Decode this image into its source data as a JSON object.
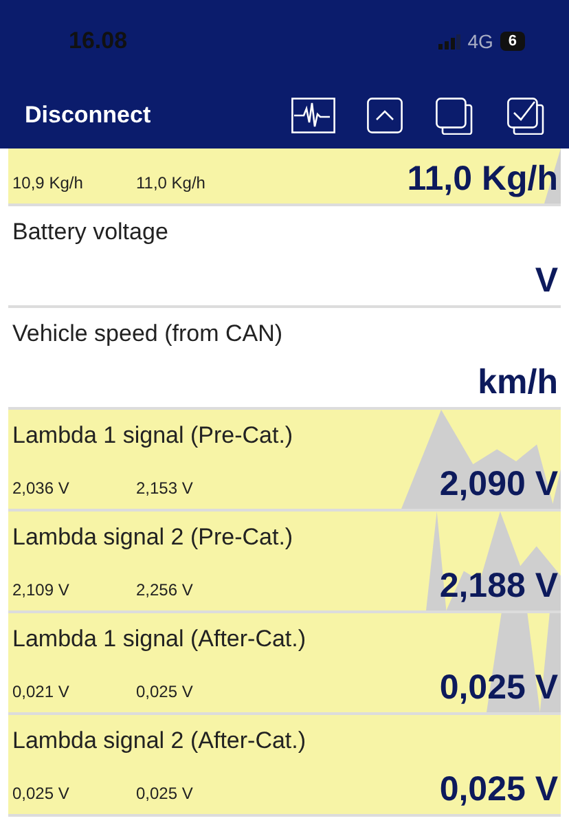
{
  "status_bar": {
    "time": "16.08",
    "network": "4G",
    "battery": "6"
  },
  "nav_bar": {
    "disconnect": "Disconnect"
  },
  "rows": [
    {
      "title": null,
      "highlighted": true,
      "graph": true,
      "min": "10,9 Kg/h",
      "max": "11,0 Kg/h",
      "value": "11,0 Kg/h"
    },
    {
      "title": "Battery voltage",
      "highlighted": false,
      "graph": false,
      "value": "V"
    },
    {
      "title": "Vehicle speed (from CAN)",
      "highlighted": false,
      "graph": false,
      "value": "km/h"
    },
    {
      "title": "Lambda 1 signal (Pre-Cat.)",
      "highlighted": true,
      "graph": true,
      "min": "2,036 V",
      "max": "2,153 V",
      "value": "2,090 V"
    },
    {
      "title": "Lambda signal 2 (Pre-Cat.)",
      "highlighted": true,
      "graph": true,
      "min": "2,109 V",
      "max": "2,256 V",
      "value": "2,188 V"
    },
    {
      "title": "Lambda 1 signal (After-Cat.)",
      "highlighted": true,
      "graph": true,
      "min": "0,021 V",
      "max": "0,025 V",
      "value": "0,025 V"
    },
    {
      "title": "Lambda signal 2 (After-Cat.)",
      "highlighted": true,
      "graph": false,
      "min": "0,025 V",
      "max": "0,025 V",
      "value": "0,025 V"
    }
  ]
}
